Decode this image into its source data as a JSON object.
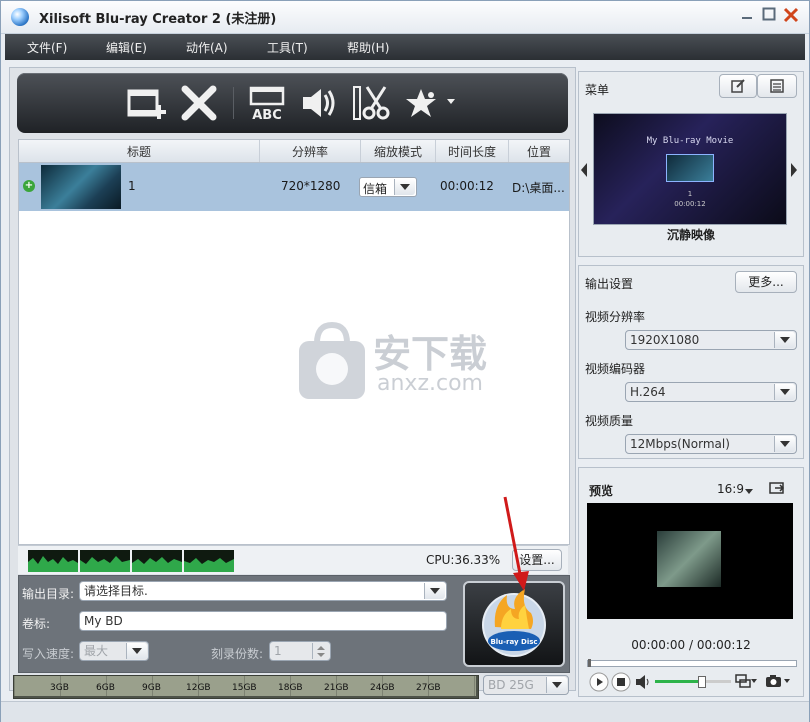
{
  "window": {
    "title": "Xilisoft Blu-ray Creator 2 (未注册)"
  },
  "menubar": {
    "items": [
      "文件(F)",
      "编辑(E)",
      "动作(A)",
      "工具(T)",
      "帮助(H)"
    ]
  },
  "toolbar": {
    "icons": [
      "add-file-icon",
      "delete-icon",
      "subtitle-abc-icon",
      "audio-icon",
      "cut-icon",
      "effects-star-icon"
    ],
    "abc_label": "ABC"
  },
  "table": {
    "headers": [
      "标题",
      "分辨率",
      "缩放模式",
      "时间长度",
      "位置"
    ],
    "rows": [
      {
        "title": "1",
        "resolution": "720*1280",
        "zoom": "信箱",
        "duration": "00:00:12",
        "location": "D:\\桌面..."
      }
    ]
  },
  "watermark": {
    "cn": "安下载",
    "en": "anxz.com"
  },
  "cpu": {
    "label": "CPU:36.33%",
    "settings_button": "设置..."
  },
  "output": {
    "dir_label": "输出目录:",
    "dir_value": "请选择目标.",
    "volume_label": "卷标:",
    "volume_value": "My BD",
    "speed_label": "写入速度:",
    "speed_value": "最大",
    "copies_label": "刻录份数:",
    "copies_value": "1"
  },
  "capacity": {
    "ticks": [
      "3GB",
      "6GB",
      "9GB",
      "12GB",
      "15GB",
      "18GB",
      "21GB",
      "24GB",
      "27GB"
    ],
    "disc_value": "BD 25G"
  },
  "menu_panel": {
    "title": "菜单",
    "preview_title": "My Blu-ray Movie",
    "preview_index": "1",
    "preview_footer": "00:00:12",
    "template_name": "沉静映像"
  },
  "output_settings": {
    "title": "输出设置",
    "more_button": "更多...",
    "resolution_label": "视频分辨率",
    "resolution_value": "1920X1080",
    "codec_label": "视频编码器",
    "codec_value": "H.264",
    "quality_label": "视频质量",
    "quality_value": "12Mbps(Normal)"
  },
  "preview": {
    "title": "预览",
    "aspect": "16:9",
    "time": "00:00:00 / 00:00:12",
    "volume_level": 0.6
  },
  "colors": {
    "accent": "#a9c3dd",
    "toolbar": "#2a2d31",
    "burn_button": "#1a5fb4"
  }
}
